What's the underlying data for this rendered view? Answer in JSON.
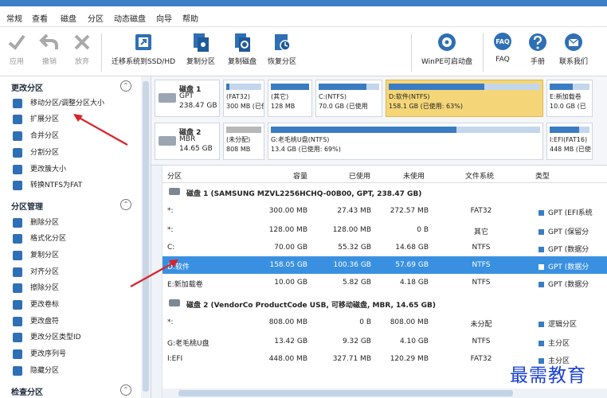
{
  "menu": [
    "常规",
    "查看",
    "磁盘",
    "分区",
    "动态磁盘",
    "向导",
    "帮助"
  ],
  "toolbar": {
    "apply": "应用",
    "undo": "撤销",
    "discard": "放弃",
    "migrate": "迁移系统到SSD/HD",
    "copy_partition": "复制分区",
    "copy_disk": "复制磁盘",
    "restore_partition": "恢复分区",
    "winpe": "WinPE可启动盘",
    "faq": "FAQ",
    "manual": "手册",
    "contact": "联系我们",
    "faq_badge": "FAQ"
  },
  "sidebar": {
    "sections": [
      {
        "title": "更改分区",
        "collapse": "⌃",
        "items": [
          "移动分区/调整分区大小",
          "扩展分区",
          "合并分区",
          "分割分区",
          "更改簇大小",
          "转换NTFS为FAT"
        ]
      },
      {
        "title": "分区管理",
        "collapse": "⌃",
        "items": [
          "删除分区",
          "格式化分区",
          "复制分区",
          "对齐分区",
          "擦除分区",
          "更改卷标",
          "更改盘符",
          "更改分区类型ID",
          "更改序列号",
          "隐藏分区"
        ]
      },
      {
        "title": "检查分区",
        "collapse": "⌃",
        "items": []
      }
    ]
  },
  "disks_map": [
    {
      "name": "磁盘 1",
      "type": "GPT",
      "size": "238.47 GB",
      "parts": [
        {
          "l1": "(FAT32)",
          "l2": "300 MB (已使",
          "fill": 0.09,
          "sel": false
        },
        {
          "l1": "(其它)",
          "l2": "128 MB",
          "fill": 1.0,
          "sel": false
        },
        {
          "l1": "C:(NTFS)",
          "l2": "70.0 GB (已使用",
          "fill": 0.79,
          "sel": false
        },
        {
          "l1": "D:软件(NTFS)",
          "l2": "158.1 GB (已使用: 63%)",
          "fill": 0.63,
          "sel": true
        },
        {
          "l1": "E:新加载卷",
          "l2": "10.0 GB (已",
          "fill": 0.58,
          "sel": false
        }
      ]
    },
    {
      "name": "磁盘 2",
      "type": "MBR",
      "size": "14.65 GB",
      "parts": [
        {
          "l1": "(未分配)",
          "l2": "808 MB",
          "fill": 0.0,
          "sel": false,
          "gray": true
        },
        {
          "l1": "G:老毛桃U盘(NTFS)",
          "l2": "13.4 GB (已使用: 69%)",
          "fill": 0.69,
          "sel": false
        },
        {
          "l1": "I:EFI(FAT16)",
          "l2": "448 MB (已使",
          "fill": 0.73,
          "sel": false
        }
      ]
    }
  ],
  "table": {
    "headers": {
      "partition": "分区",
      "capacity": "容量",
      "used": "已使用",
      "unused": "未使用",
      "fs": "文件系统",
      "type": "类型"
    },
    "disk1_header": "磁盘 1 (SAMSUNG MZVL2256HCHQ-00B00, GPT, 238.47 GB)",
    "disk2_header": "磁盘 2 (VendorCo ProductCode USB, 可移动磁盘, MBR, 14.65 GB)",
    "disk1_rows": [
      {
        "name": "*:",
        "cap": "300.00 MB",
        "used": "27.43 MB",
        "unused": "272.57 MB",
        "fs": "FAT32",
        "type": "GPT (EFI系统",
        "sel": false
      },
      {
        "name": "*:",
        "cap": "128.00 MB",
        "used": "128.00 MB",
        "unused": "0 B",
        "fs": "其它",
        "type": "GPT (保留分",
        "sel": false
      },
      {
        "name": "C:",
        "cap": "70.00 GB",
        "used": "55.32 GB",
        "unused": "14.68 GB",
        "fs": "NTFS",
        "type": "GPT (数据分",
        "sel": false
      },
      {
        "name": "D:软件",
        "cap": "158.05 GB",
        "used": "100.36 GB",
        "unused": "57.69 GB",
        "fs": "NTFS",
        "type": "GPT (数据分",
        "sel": true
      },
      {
        "name": "E:新加载卷",
        "cap": "10.00 GB",
        "used": "5.82 GB",
        "unused": "4.18 GB",
        "fs": "NTFS",
        "type": "GPT (数据分",
        "sel": false
      }
    ],
    "disk2_rows": [
      {
        "name": "*:",
        "cap": "808.00 MB",
        "used": "0 B",
        "unused": "808.00 MB",
        "fs": "未分配",
        "type": "逻辑分区",
        "sel": false
      },
      {
        "name": "G:老毛桃U盘",
        "cap": "13.42 GB",
        "used": "9.32 GB",
        "unused": "4.10 GB",
        "fs": "NTFS",
        "type": "主分区",
        "sel": false
      },
      {
        "name": "I:EFI",
        "cap": "448.00 MB",
        "used": "327.71 MB",
        "unused": "120.29 MB",
        "fs": "FAT32",
        "type": "主分区",
        "sel": false
      }
    ]
  },
  "watermark": "最需教育",
  "colors": {
    "accent": "#3a7cc3",
    "selected_row": "#3a90e0",
    "selected_block": "#f4d678",
    "arrow": "#d8232a"
  }
}
